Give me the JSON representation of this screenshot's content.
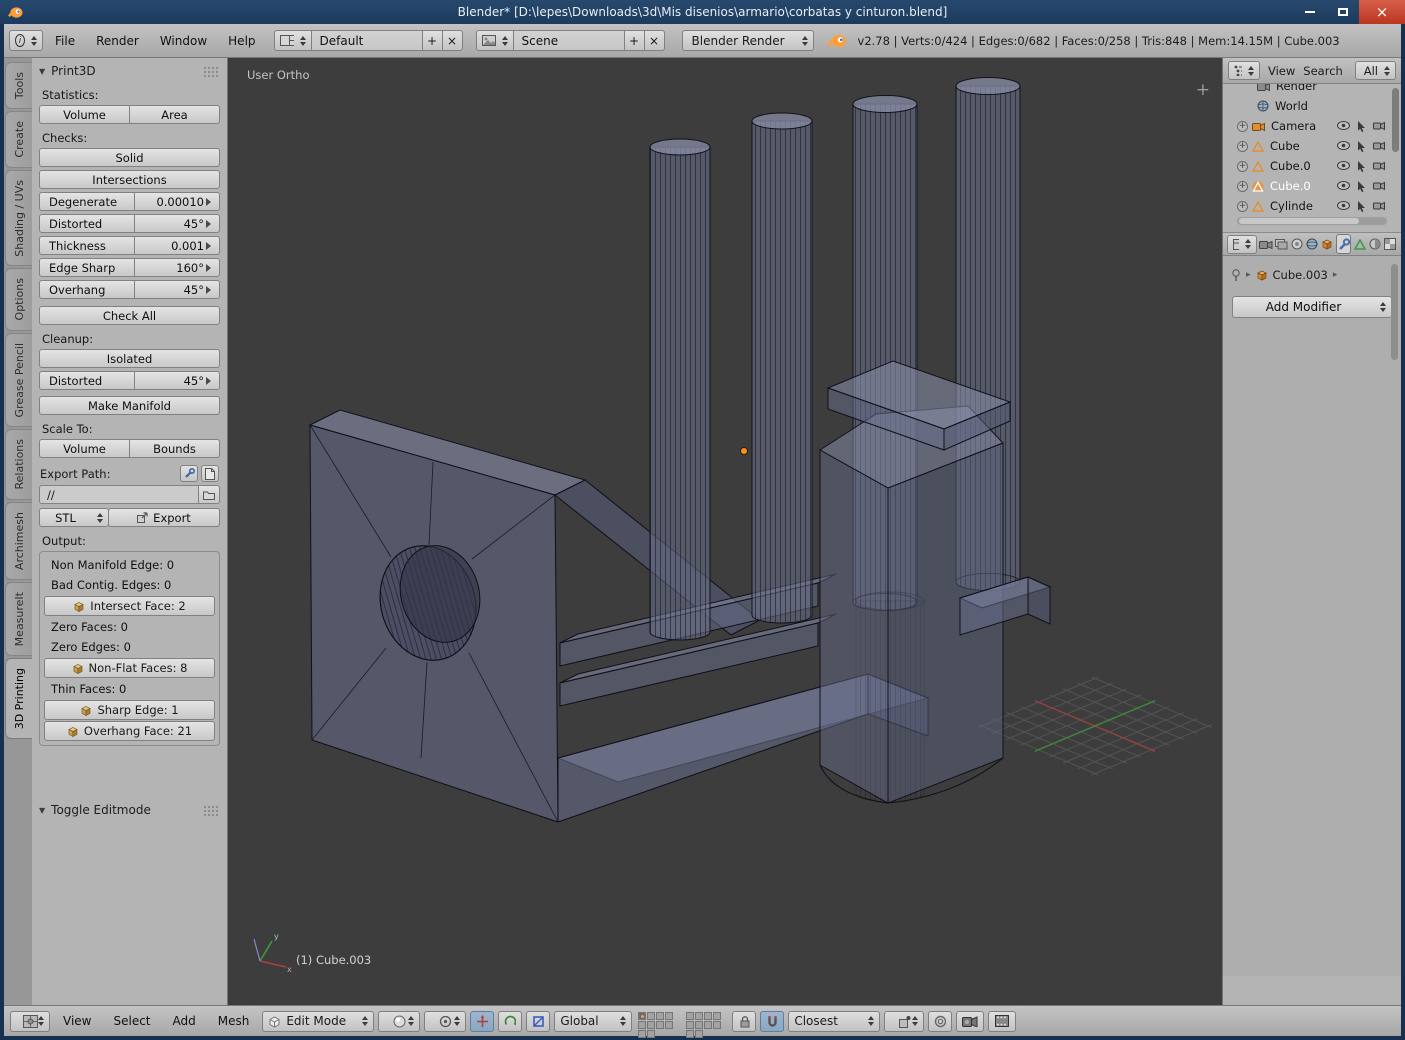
{
  "icons": {
    "collapse": "▼",
    "plus": "+",
    "close": "×",
    "crumb": "▸",
    "viewport_add": "+",
    "expand_plus": "+"
  },
  "window": {
    "title": "Blender* [D:\\lepes\\Downloads\\3d\\Mis disenios\\armario\\corbatas y cinturon.blend]"
  },
  "menubar": {
    "menus": [
      "File",
      "Render",
      "Window",
      "Help"
    ],
    "layout_name": "Default",
    "scene_name": "Scene",
    "engine": "Blender Render",
    "stats": "v2.78 | Verts:0/424 | Edges:0/682 | Faces:0/258 | Tris:848 | Mem:14.15M | Cube.003"
  },
  "left_tabs": [
    {
      "label": "Tools"
    },
    {
      "label": "Create"
    },
    {
      "label": "Shading / UVs"
    },
    {
      "label": "Options"
    },
    {
      "label": "Grease Pencil"
    },
    {
      "label": "Relations"
    },
    {
      "label": "Archimesh"
    },
    {
      "label": "MeasureIt"
    },
    {
      "label": "3D Printing"
    }
  ],
  "print3d": {
    "title": "Print3D",
    "statistics_label": "Statistics:",
    "volume_button": "Volume",
    "area_button": "Area",
    "checks_label": "Checks:",
    "solid_button": "Solid",
    "intersections_button": "Intersections",
    "degenerate": {
      "label": "Degenerate",
      "value": "0.00010"
    },
    "distorted": {
      "label": "Distorted",
      "value": "45°"
    },
    "thickness": {
      "label": "Thickness",
      "value": "0.001"
    },
    "edge_sharp": {
      "label": "Edge Sharp",
      "value": "160°"
    },
    "overhang": {
      "label": "Overhang",
      "value": "45°"
    },
    "check_all_button": "Check All",
    "cleanup_label": "Cleanup:",
    "isolated_button": "Isolated",
    "cleanup_distorted": {
      "label": "Distorted",
      "value": "45°"
    },
    "make_manifold_button": "Make Manifold",
    "scale_to_label": "Scale To:",
    "scale_volume_button": "Volume",
    "scale_bounds_button": "Bounds",
    "export_path_label": "Export Path:",
    "export_path_value": "//",
    "format_select": "STL",
    "export_button": "Export",
    "output_label": "Output:",
    "output_rows": [
      {
        "text": "Non Manifold Edge: 0",
        "style": "plain"
      },
      {
        "text": "Bad Contig. Edges: 0",
        "style": "plain"
      },
      {
        "text": "Intersect Face: 2",
        "style": "button"
      },
      {
        "text": "Zero Faces: 0",
        "style": "plain"
      },
      {
        "text": "Zero Edges: 0",
        "style": "plain"
      },
      {
        "text": "Non-Flat Faces: 8",
        "style": "button"
      },
      {
        "text": "Thin Faces: 0",
        "style": "plain"
      },
      {
        "text": "Sharp Edge: 1",
        "style": "button"
      },
      {
        "text": "Overhang Face: 21",
        "style": "button"
      }
    ]
  },
  "toggle_editmode_panel": {
    "title": "Toggle Editmode"
  },
  "viewport": {
    "view_mode": "User Ortho",
    "active_object": "(1) Cube.003"
  },
  "outliner": {
    "tabs": [
      "View",
      "Search",
      "All"
    ],
    "items": [
      {
        "label": "Render"
      },
      {
        "label": "World"
      },
      {
        "label": "Camera"
      },
      {
        "label": "Cube"
      },
      {
        "label": "Cube.0"
      },
      {
        "label": "Cube.0"
      },
      {
        "label": "Cylinde"
      }
    ]
  },
  "properties": {
    "breadcrumb_object": "Cube.003",
    "add_modifier_button": "Add Modifier"
  },
  "bottom_bar": {
    "menus": [
      "View",
      "Select",
      "Add",
      "Mesh"
    ],
    "mode": "Edit Mode",
    "orientation": "Global",
    "snap_mode": "Closest"
  },
  "colors": {
    "titlebar": "#1d3b5e",
    "close_button": "#c23a24",
    "panel_gray": "#b4b4b4",
    "viewport_bg": "#3d3d3d",
    "accent_orange": "#ff9c33",
    "mesh_fill": "#6a6f8e"
  }
}
